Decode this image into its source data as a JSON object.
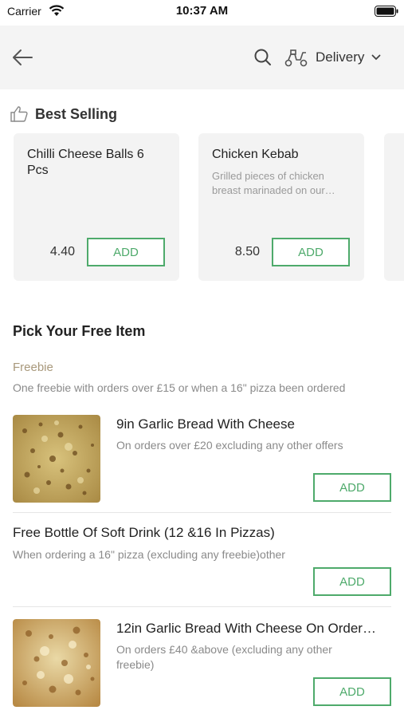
{
  "status_bar": {
    "carrier": "Carrier",
    "time": "10:37 AM"
  },
  "header": {
    "delivery_label": "Delivery"
  },
  "best_selling": {
    "title": "Best Selling",
    "items": [
      {
        "name": "Chilli Cheese Balls 6 Pcs",
        "description": "",
        "price": "4.40",
        "add_label": "ADD"
      },
      {
        "name": "Chicken Kebab",
        "description": "Grilled pieces of chicken breast marinaded on our…",
        "price": "8.50",
        "add_label": "ADD"
      }
    ]
  },
  "free_items": {
    "title": "Pick Your Free Item",
    "category": "Freebie",
    "category_description": "One freebie with orders over £15 or when a 16\" pizza been ordered",
    "items": [
      {
        "name": "9in Garlic Bread With Cheese",
        "description": "On orders over £20 excluding any other offers",
        "add_label": "ADD"
      },
      {
        "name": "Free Bottle Of Soft Drink (12 &16 In Pizzas)",
        "description": "When ordering a 16\" pizza (excluding any  freebie)other",
        "add_label": "ADD"
      },
      {
        "name": "12in Garlic Bread With Cheese On Order…",
        "description": "On orders £40 &above (excluding any other freebie)",
        "add_label": "ADD"
      }
    ]
  },
  "colors": {
    "accent_green": "#4eaa6b",
    "header_bg": "#f4f4f4",
    "card_bg": "#f3f3f3",
    "freebie_label": "#a8987b"
  }
}
